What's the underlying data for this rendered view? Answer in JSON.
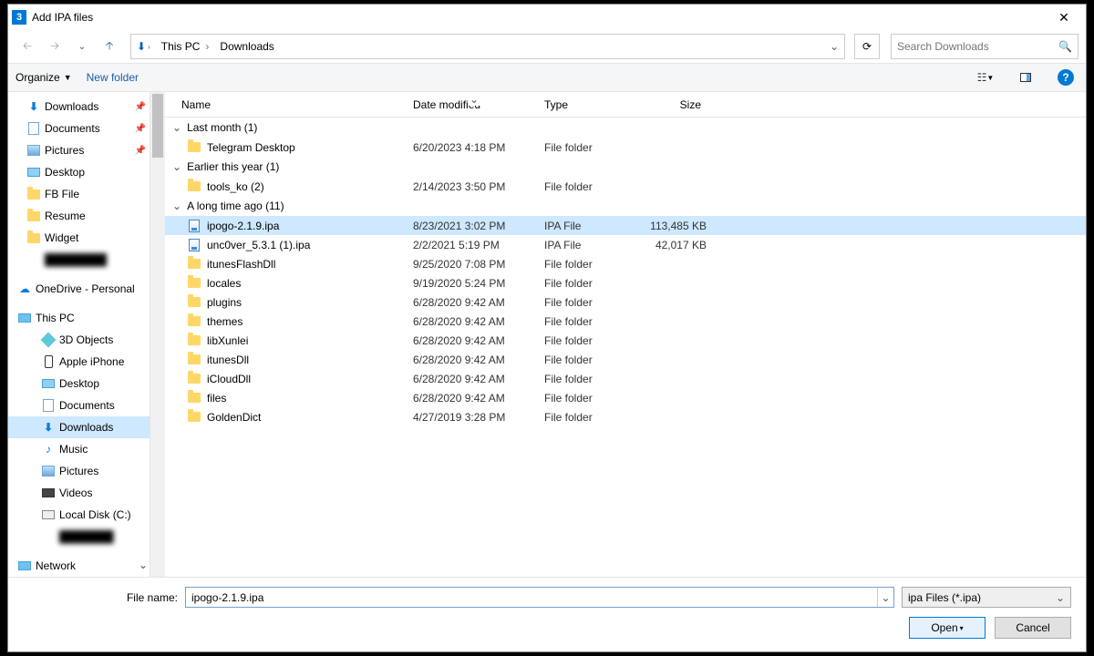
{
  "window": {
    "title": "Add IPA files"
  },
  "breadcrumbs": [
    "This PC",
    "Downloads"
  ],
  "search": {
    "placeholder": "Search Downloads"
  },
  "toolbar": {
    "organize": "Organize",
    "new_folder": "New folder"
  },
  "sidebar": {
    "quick": [
      {
        "label": "Downloads",
        "icon": "download",
        "pinned": true
      },
      {
        "label": "Documents",
        "icon": "doc",
        "pinned": true
      },
      {
        "label": "Pictures",
        "icon": "pic",
        "pinned": true
      },
      {
        "label": "Desktop",
        "icon": "desk"
      },
      {
        "label": "FB File",
        "icon": "folder"
      },
      {
        "label": "Resume",
        "icon": "folder"
      },
      {
        "label": "Widget",
        "icon": "folder"
      }
    ],
    "onedrive": "OneDrive - Personal",
    "thispc_label": "This PC",
    "thispc": [
      {
        "label": "3D Objects",
        "icon": "threed"
      },
      {
        "label": "Apple iPhone",
        "icon": "phone"
      },
      {
        "label": "Desktop",
        "icon": "desk"
      },
      {
        "label": "Documents",
        "icon": "doc"
      },
      {
        "label": "Downloads",
        "icon": "download",
        "active": true
      },
      {
        "label": "Music",
        "icon": "music"
      },
      {
        "label": "Pictures",
        "icon": "pic"
      },
      {
        "label": "Videos",
        "icon": "vid"
      },
      {
        "label": "Local Disk (C:)",
        "icon": "disk"
      }
    ],
    "network": "Network"
  },
  "columns": {
    "name": "Name",
    "date": "Date modified",
    "type": "Type",
    "size": "Size"
  },
  "groups": [
    {
      "label": "Last month (1)",
      "rows": [
        {
          "name": "Telegram Desktop",
          "date": "6/20/2023 4:18 PM",
          "type": "File folder",
          "size": "",
          "icon": "folder"
        }
      ]
    },
    {
      "label": "Earlier this year (1)",
      "rows": [
        {
          "name": "tools_ko (2)",
          "date": "2/14/2023 3:50 PM",
          "type": "File folder",
          "size": "",
          "icon": "folder"
        }
      ]
    },
    {
      "label": "A long time ago (11)",
      "rows": [
        {
          "name": "ipogo-2.1.9.ipa",
          "date": "8/23/2021 3:02 PM",
          "type": "IPA File",
          "size": "113,485 KB",
          "icon": "ipa",
          "selected": true
        },
        {
          "name": "unc0ver_5.3.1 (1).ipa",
          "date": "2/2/2021 5:19 PM",
          "type": "IPA File",
          "size": "42,017 KB",
          "icon": "ipa"
        },
        {
          "name": "itunesFlashDll",
          "date": "9/25/2020 7:08 PM",
          "type": "File folder",
          "size": "",
          "icon": "folder"
        },
        {
          "name": "locales",
          "date": "9/19/2020 5:24 PM",
          "type": "File folder",
          "size": "",
          "icon": "folder"
        },
        {
          "name": "plugins",
          "date": "6/28/2020 9:42 AM",
          "type": "File folder",
          "size": "",
          "icon": "folder"
        },
        {
          "name": "themes",
          "date": "6/28/2020 9:42 AM",
          "type": "File folder",
          "size": "",
          "icon": "folder"
        },
        {
          "name": "libXunlei",
          "date": "6/28/2020 9:42 AM",
          "type": "File folder",
          "size": "",
          "icon": "folder"
        },
        {
          "name": "itunesDll",
          "date": "6/28/2020 9:42 AM",
          "type": "File folder",
          "size": "",
          "icon": "folder"
        },
        {
          "name": "iCloudDll",
          "date": "6/28/2020 9:42 AM",
          "type": "File folder",
          "size": "",
          "icon": "folder"
        },
        {
          "name": "files",
          "date": "6/28/2020 9:42 AM",
          "type": "File folder",
          "size": "",
          "icon": "folder"
        },
        {
          "name": "GoldenDict",
          "date": "4/27/2019 3:28 PM",
          "type": "File folder",
          "size": "",
          "icon": "folder"
        }
      ]
    }
  ],
  "footer": {
    "filename_label": "File name:",
    "filename_value": "ipogo-2.1.9.ipa",
    "filter": "ipa Files (*.ipa)",
    "open": "Open",
    "cancel": "Cancel"
  }
}
